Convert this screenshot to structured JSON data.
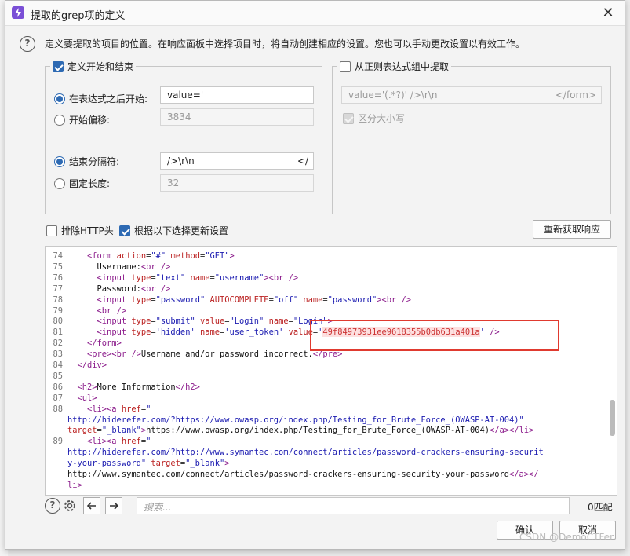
{
  "window": {
    "title": "提取的grep项的定义",
    "close_label": "✕"
  },
  "description": "定义要提取的项目的位置。在响应面板中选择项目时，将自动创建相应的设置。您也可以手动更改设置以有效工作。",
  "start_end_group": {
    "label": "定义开始和结束",
    "checked": true,
    "after_expr_label": "在表达式之后开始:",
    "after_expr_value": "value='",
    "start_offset_label": "开始偏移:",
    "start_offset_value": "3834",
    "end_delim_label": "结束分隔符:",
    "end_delim_value": "/>\\r\\n",
    "end_delim_value_right": "</",
    "fixed_length_label": "固定长度:",
    "fixed_length_value": "32"
  },
  "regex_group": {
    "label": "从正则表达式组中提取",
    "checked": false,
    "regex_value": "value='(.*?)' />\\r\\n",
    "regex_value_right": "</form>",
    "case_sensitive_label": "区分大小写",
    "case_sensitive_checked": true
  },
  "options": {
    "exclude_http_label": "排除HTTP头",
    "exclude_http_checked": false,
    "update_config_label": "根据以下选择更新设置",
    "update_config_checked": true,
    "refetch_button": "重新获取响应"
  },
  "code_lines": [
    {
      "n": "74",
      "indent": "    ",
      "html": "<span class='tag'>&lt;form</span> <span class='attr'>action</span>=<span class='val'>\"#\"</span> <span class='attr'>method</span>=<span class='val'>\"GET\"</span><span class='tag'>&gt;</span>"
    },
    {
      "n": "75",
      "indent": "      ",
      "html": "<span class='txt'>Username:</span><span class='tag'>&lt;br /&gt;</span>"
    },
    {
      "n": "76",
      "indent": "      ",
      "html": "<span class='tag'>&lt;input</span> <span class='attr'>type</span>=<span class='val'>\"text\"</span> <span class='attr'>name</span>=<span class='val'>\"username\"</span><span class='tag'>&gt;&lt;br /&gt;</span>"
    },
    {
      "n": "77",
      "indent": "      ",
      "html": "<span class='txt'>Password:</span><span class='tag'>&lt;br /&gt;</span>"
    },
    {
      "n": "78",
      "indent": "      ",
      "html": "<span class='tag'>&lt;input</span> <span class='attr'>type</span>=<span class='val'>\"password\"</span> <span class='attr'>AUTOCOMPLETE</span>=<span class='val'>\"off\"</span> <span class='attr'>name</span>=<span class='val'>\"password\"</span><span class='tag'>&gt;&lt;br /&gt;</span>"
    },
    {
      "n": "79",
      "indent": "      ",
      "html": "<span class='tag'>&lt;br /&gt;</span>"
    },
    {
      "n": "80",
      "indent": "      ",
      "html": "<span class='tag'>&lt;input</span> <span class='attr'>type</span>=<span class='val'>\"submit\"</span> <span class='attr'>value</span>=<span class='val'>\"Login\"</span> <span class='attr'>name</span>=<span class='val'>\"Login\"</span><span class='tag'>&gt;</span>"
    },
    {
      "n": "81",
      "indent": "      ",
      "html": "<span class='tag'>&lt;input</span> <span class='attr'>type</span>=<span class='val'>'hidden'</span> <span class='attr'>name</span>=<span class='val'>'user_token'</span> <span class='attr'>value</span>=<span class='val'>'</span><span class='hl'>49f84973931ee9618355b0db631a401a</span><span class='val'>'</span> <span class='tag'>/&gt;</span>"
    },
    {
      "n": "82",
      "indent": "    ",
      "html": "<span class='tag'>&lt;/form&gt;</span>"
    },
    {
      "n": "83",
      "indent": "    ",
      "html": "<span class='tag'>&lt;pre&gt;&lt;br /&gt;</span><span class='txt'>Username and/or password incorrect.</span><span class='tag'>&lt;/pre&gt;</span>"
    },
    {
      "n": "84",
      "indent": "  ",
      "html": "<span class='tag'>&lt;/div&gt;</span>"
    },
    {
      "n": "85",
      "indent": "",
      "html": ""
    },
    {
      "n": "86",
      "indent": "  ",
      "html": "<span class='tag'>&lt;h2&gt;</span><span class='txt'>More Information</span><span class='tag'>&lt;/h2&gt;</span>"
    },
    {
      "n": "87",
      "indent": "  ",
      "html": "<span class='tag'>&lt;ul&gt;</span>"
    },
    {
      "n": "88",
      "indent": "    ",
      "html": "<span class='tag'>&lt;li&gt;&lt;a</span> <span class='attr'>href</span>=<span class='val'>\"</span>"
    },
    {
      "n": "",
      "indent": "",
      "html": "<span class='val'>http://hiderefer.com/?https://www.owasp.org/index.php/Testing_for_Brute_Force_(OWASP-AT-004)\"</span>"
    },
    {
      "n": "",
      "indent": "",
      "html": "<span class='attr'>target</span>=<span class='val'>\"_blank\"</span><span class='tag'>&gt;</span><span class='txt'>https://www.owasp.org/index.php/Testing_for_Brute_Force_(OWASP-AT-004)</span><span class='tag'>&lt;/a&gt;&lt;/li&gt;</span>"
    },
    {
      "n": "89",
      "indent": "    ",
      "html": "<span class='tag'>&lt;li&gt;&lt;a</span> <span class='attr'>href</span>=<span class='val'>\"</span>"
    },
    {
      "n": "",
      "indent": "",
      "html": "<span class='val'>http://hiderefer.com/?http://www.symantec.com/connect/articles/password-crackers-ensuring-securit</span>"
    },
    {
      "n": "",
      "indent": "",
      "html": "<span class='val'>y-your-password\"</span> <span class='attr'>target</span>=<span class='val'>\"_blank\"</span><span class='tag'>&gt;</span>"
    },
    {
      "n": "",
      "indent": "",
      "html": "<span class='txt'>http://www.symantec.com/connect/articles/password-crackers-ensuring-security-your-password</span><span class='tag'>&lt;/a&gt;&lt;/</span>"
    },
    {
      "n": "",
      "indent": "",
      "html": "<span class='tag'>li&gt;</span>"
    }
  ],
  "search": {
    "placeholder": "搜索...",
    "matches": "0匹配"
  },
  "buttons": {
    "ok": "确认",
    "cancel": "取消"
  },
  "watermark": "CSDN @DemoCTFer"
}
